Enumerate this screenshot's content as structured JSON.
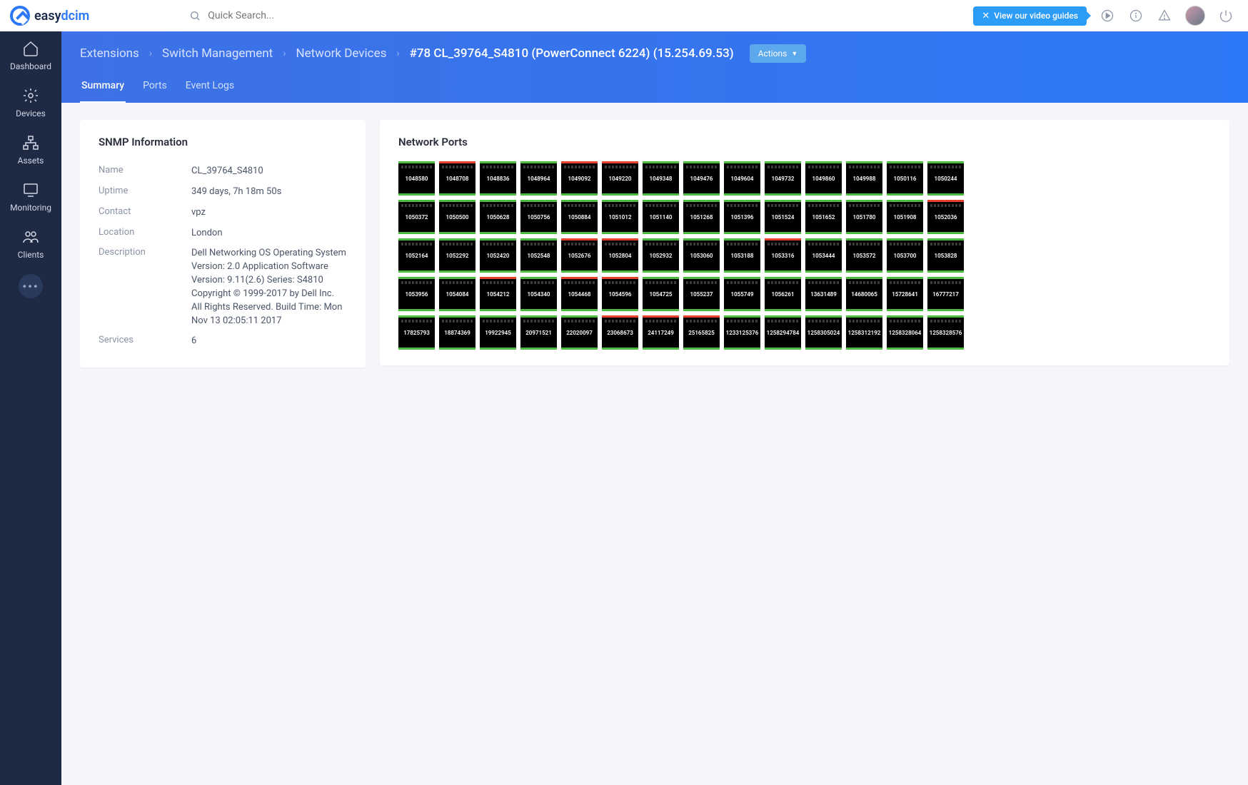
{
  "brand": {
    "name_a": "easy",
    "name_b": "dcim"
  },
  "search": {
    "placeholder": "Quick Search..."
  },
  "video_guide": "View our video guides",
  "sidebar": {
    "items": [
      {
        "label": "Dashboard"
      },
      {
        "label": "Devices"
      },
      {
        "label": "Assets"
      },
      {
        "label": "Monitoring"
      },
      {
        "label": "Clients"
      }
    ]
  },
  "breadcrumb": {
    "items": [
      "Extensions",
      "Switch Management",
      "Network Devices"
    ],
    "current": "#78 CL_39764_S4810 (PowerConnect 6224) (15.254.69.53)",
    "actions": "Actions"
  },
  "tabs": [
    {
      "label": "Summary",
      "active": true
    },
    {
      "label": "Ports"
    },
    {
      "label": "Event Logs"
    }
  ],
  "snmp": {
    "title": "SNMP Information",
    "rows": [
      {
        "k": "Name",
        "v": "CL_39764_S4810"
      },
      {
        "k": "Uptime",
        "v": "349 days, 7h 18m 50s"
      },
      {
        "k": "Contact",
        "v": "vpz"
      },
      {
        "k": "Location",
        "v": "London"
      },
      {
        "k": "Description",
        "v": "Dell Networking OS Operating System Version: 2.0 Application Software Version: 9.11(2.6) Series: S4810 Copyright © 1999-2017 by Dell Inc. All Rights Reserved. Build Time: Mon Nov 13 02:05:11 2017"
      },
      {
        "k": "Services",
        "v": "6"
      }
    ]
  },
  "ports_title": "Network Ports",
  "ports": [
    {
      "id": "1048580",
      "top": "green",
      "bot": "green"
    },
    {
      "id": "1048708",
      "top": "red",
      "bot": "green"
    },
    {
      "id": "1048836",
      "top": "green",
      "bot": "green"
    },
    {
      "id": "1048964",
      "top": "green",
      "bot": "green"
    },
    {
      "id": "1049092",
      "top": "red",
      "bot": "green"
    },
    {
      "id": "1049220",
      "top": "red",
      "bot": "green"
    },
    {
      "id": "1049348",
      "top": "green",
      "bot": "green"
    },
    {
      "id": "1049476",
      "top": "green",
      "bot": "green"
    },
    {
      "id": "1049604",
      "top": "green",
      "bot": "green"
    },
    {
      "id": "1049732",
      "top": "green",
      "bot": "green"
    },
    {
      "id": "1049860",
      "top": "green",
      "bot": "green"
    },
    {
      "id": "1049988",
      "top": "green",
      "bot": "green"
    },
    {
      "id": "1050116",
      "top": "green",
      "bot": "green"
    },
    {
      "id": "1050244",
      "top": "green",
      "bot": "green"
    },
    {
      "id": "1050372",
      "top": "green",
      "bot": "green"
    },
    {
      "id": "1050500",
      "top": "green",
      "bot": "green"
    },
    {
      "id": "1050628",
      "top": "green",
      "bot": "green"
    },
    {
      "id": "1050756",
      "top": "green",
      "bot": "green"
    },
    {
      "id": "1050884",
      "top": "green",
      "bot": "green"
    },
    {
      "id": "1051012",
      "top": "green",
      "bot": "green"
    },
    {
      "id": "1051140",
      "top": "green",
      "bot": "green"
    },
    {
      "id": "1051268",
      "top": "green",
      "bot": "green"
    },
    {
      "id": "1051396",
      "top": "green",
      "bot": "green"
    },
    {
      "id": "1051524",
      "top": "green",
      "bot": "green"
    },
    {
      "id": "1051652",
      "top": "green",
      "bot": "green"
    },
    {
      "id": "1051780",
      "top": "green",
      "bot": "green"
    },
    {
      "id": "1051908",
      "top": "green",
      "bot": "green"
    },
    {
      "id": "1052036",
      "top": "red",
      "bot": "green"
    },
    {
      "id": "1052164",
      "top": "green",
      "bot": "green"
    },
    {
      "id": "1052292",
      "top": "green",
      "bot": "green"
    },
    {
      "id": "1052420",
      "top": "green",
      "bot": "green"
    },
    {
      "id": "1052548",
      "top": "green",
      "bot": "green"
    },
    {
      "id": "1052676",
      "top": "red",
      "bot": "green"
    },
    {
      "id": "1052804",
      "top": "red",
      "bot": "green"
    },
    {
      "id": "1052932",
      "top": "green",
      "bot": "green"
    },
    {
      "id": "1053060",
      "top": "green",
      "bot": "green"
    },
    {
      "id": "1053188",
      "top": "green",
      "bot": "green"
    },
    {
      "id": "1053316",
      "top": "red",
      "bot": "green"
    },
    {
      "id": "1053444",
      "top": "green",
      "bot": "green"
    },
    {
      "id": "1053572",
      "top": "green",
      "bot": "green"
    },
    {
      "id": "1053700",
      "top": "green",
      "bot": "green"
    },
    {
      "id": "1053828",
      "top": "green",
      "bot": "green"
    },
    {
      "id": "1053956",
      "top": "green",
      "bot": "green"
    },
    {
      "id": "1054084",
      "top": "green",
      "bot": "green"
    },
    {
      "id": "1054212",
      "top": "red",
      "bot": "green"
    },
    {
      "id": "1054340",
      "top": "green",
      "bot": "green"
    },
    {
      "id": "1054468",
      "top": "red",
      "bot": "green"
    },
    {
      "id": "1054596",
      "top": "red",
      "bot": "green"
    },
    {
      "id": "1054725",
      "top": "green",
      "bot": "green"
    },
    {
      "id": "1055237",
      "top": "green",
      "bot": "green"
    },
    {
      "id": "1055749",
      "top": "green",
      "bot": "green"
    },
    {
      "id": "1056261",
      "top": "green",
      "bot": "green"
    },
    {
      "id": "13631489",
      "top": "green",
      "bot": "green"
    },
    {
      "id": "14680065",
      "top": "green",
      "bot": "green"
    },
    {
      "id": "15728641",
      "top": "green",
      "bot": "green"
    },
    {
      "id": "16777217",
      "top": "green",
      "bot": "green"
    },
    {
      "id": "17825793",
      "top": "green",
      "bot": "green"
    },
    {
      "id": "18874369",
      "top": "green",
      "bot": "green"
    },
    {
      "id": "19922945",
      "top": "green",
      "bot": "green"
    },
    {
      "id": "20971521",
      "top": "green",
      "bot": "green"
    },
    {
      "id": "22020097",
      "top": "green",
      "bot": "green"
    },
    {
      "id": "23068673",
      "top": "red",
      "bot": "green"
    },
    {
      "id": "24117249",
      "top": "red",
      "bot": "green"
    },
    {
      "id": "25165825",
      "top": "red",
      "bot": "green"
    },
    {
      "id": "1233125376",
      "top": "green",
      "bot": "green"
    },
    {
      "id": "1258294784",
      "top": "green",
      "bot": "green"
    },
    {
      "id": "1258305024",
      "top": "green",
      "bot": "green"
    },
    {
      "id": "1258312192",
      "top": "green",
      "bot": "green"
    },
    {
      "id": "1258328064",
      "top": "green",
      "bot": "green"
    },
    {
      "id": "1258328576",
      "top": "green",
      "bot": "green"
    }
  ]
}
